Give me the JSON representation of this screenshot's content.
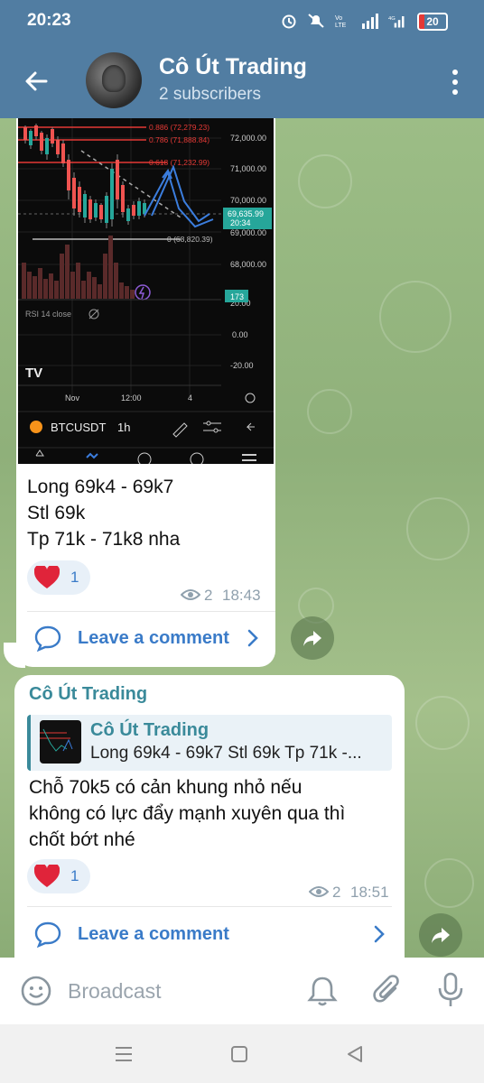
{
  "status_bar": {
    "time": "20:23",
    "battery": "20",
    "network": "4G"
  },
  "header": {
    "title": "Cô Út Trading",
    "subtitle": "2 subscribers"
  },
  "chart_image": {
    "fib_levels": [
      {
        "label": "0.886 (72,279.23)"
      },
      {
        "label": "0.786 (71,888.84)"
      },
      {
        "label": "0.618 (71,232.99)"
      },
      {
        "label": "0 (68,820.39)"
      }
    ],
    "price_ticks": [
      "72,000.00",
      "71,000.00",
      "70,000.00",
      "69,000.00",
      "68,000.00",
      "20.00",
      "0.00",
      "-20.00"
    ],
    "current_price": "69,635.99",
    "countdown": "20:34",
    "volume_badge": "173",
    "rsi_label": "RSI 14 close",
    "time_ticks": [
      "Nov",
      "12:00",
      "4"
    ],
    "symbol": "BTCUSDT",
    "interval": "1h"
  },
  "messages": [
    {
      "lines": [
        "Long 69k4 - 69k7",
        "Stl 69k",
        "Tp 71k - 71k8 nha"
      ],
      "reaction_count": "1",
      "views": "2",
      "time": "18:43",
      "comment_label": "Leave a comment"
    },
    {
      "author": "Cô Út Trading",
      "reply": {
        "name": "Cô Út Trading",
        "text": "Long 69k4 - 69k7 Stl 69k Tp 71k -..."
      },
      "lines": [
        "Chỗ 70k5 có cản khung nhỏ nếu",
        "không có lực đẩy mạnh xuyên qua thì",
        "chốt bớt nhé"
      ],
      "reaction_count": "1",
      "views": "2",
      "time": "18:51",
      "comment_label": "Leave a comment"
    }
  ],
  "input": {
    "placeholder": "Broadcast"
  },
  "colors": {
    "header": "#517da2",
    "accent": "#3a7bc8",
    "author": "#3a8a9a"
  }
}
